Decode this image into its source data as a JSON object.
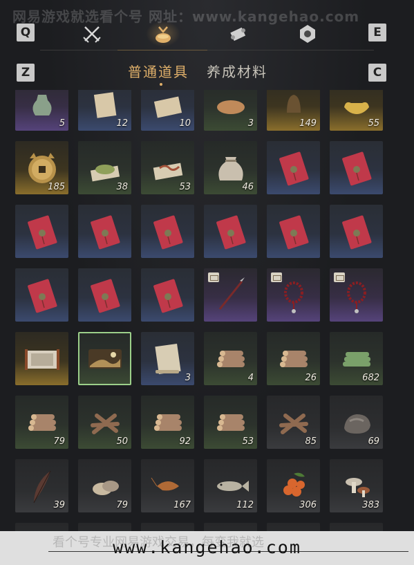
{
  "watermark": {
    "top_text": "网易游戏就选看个号  网址：www.kangehao.com",
    "bottom_url": "www.kangehao.com",
    "bottom_faint": "看个号专业网易游戏交易，每变我就选",
    "corner_mark": "看个号"
  },
  "toolbar": {
    "key_left": "Q",
    "key_right": "E",
    "icons": [
      "crossed-swords-icon",
      "money-bag-icon",
      "scroll-icon",
      "token-icon"
    ],
    "active_index": 1
  },
  "subtabs": {
    "key_left": "Z",
    "key_right": "C",
    "tab1": "普通道具",
    "tab2": "养成材料",
    "active": "普通道具"
  },
  "colors": {
    "accent": "#e0b06a",
    "rarity_blue": "#3b4a6e",
    "rarity_green": "#3c4b34",
    "rarity_purple": "#55437a",
    "rarity_gold": "#8a6e2c"
  },
  "grid": [
    {
      "rarity": "purple",
      "icon": "jade-vase-icon",
      "qty": "5"
    },
    {
      "rarity": "blue",
      "icon": "letter-icon",
      "qty": "12"
    },
    {
      "rarity": "blue",
      "icon": "paper-icon",
      "qty": "10"
    },
    {
      "rarity": "green",
      "icon": "bread-icon",
      "qty": "3"
    },
    {
      "rarity": "gold",
      "icon": "bell-icon",
      "qty": "149"
    },
    {
      "rarity": "gold",
      "icon": "gold-ingot-icon",
      "qty": "55"
    },
    {
      "rarity": "gold",
      "icon": "cat-coin-icon",
      "qty": "185"
    },
    {
      "rarity": "green",
      "icon": "powder-icon",
      "qty": "38"
    },
    {
      "rarity": "green",
      "icon": "worm-icon",
      "qty": "53"
    },
    {
      "rarity": "green",
      "icon": "cloth-sack-icon",
      "qty": "46"
    },
    {
      "rarity": "blue",
      "icon": "red-envelope-icon",
      "qty": ""
    },
    {
      "rarity": "blue",
      "icon": "red-envelope-icon",
      "qty": ""
    },
    {
      "rarity": "blue",
      "icon": "red-envelope-icon",
      "qty": ""
    },
    {
      "rarity": "blue",
      "icon": "red-envelope-icon",
      "qty": ""
    },
    {
      "rarity": "blue",
      "icon": "red-envelope-icon",
      "qty": ""
    },
    {
      "rarity": "blue",
      "icon": "red-envelope-icon",
      "qty": ""
    },
    {
      "rarity": "blue",
      "icon": "red-envelope-icon",
      "qty": ""
    },
    {
      "rarity": "blue",
      "icon": "red-envelope-icon",
      "qty": ""
    },
    {
      "rarity": "blue",
      "icon": "red-envelope-icon",
      "qty": ""
    },
    {
      "rarity": "blue",
      "icon": "red-envelope-icon",
      "qty": ""
    },
    {
      "rarity": "blue",
      "icon": "red-envelope-icon",
      "qty": ""
    },
    {
      "rarity": "purple",
      "icon": "spear-icon",
      "qty": "",
      "badge": true
    },
    {
      "rarity": "purple",
      "icon": "prayer-beads-icon",
      "qty": "",
      "badge": true
    },
    {
      "rarity": "purple",
      "icon": "prayer-beads-icon",
      "qty": "",
      "badge": true
    },
    {
      "rarity": "gold",
      "icon": "painting-scroll-icon",
      "qty": ""
    },
    {
      "rarity": "green",
      "icon": "landscape-painting-icon",
      "qty": "",
      "selected": true
    },
    {
      "rarity": "blue",
      "icon": "blank-scroll-icon",
      "qty": "3"
    },
    {
      "rarity": "green",
      "icon": "wood-logs-icon",
      "qty": "4"
    },
    {
      "rarity": "green",
      "icon": "wood-logs-icon",
      "qty": "26"
    },
    {
      "rarity": "green",
      "icon": "bamboo-bundle-icon",
      "qty": "682"
    },
    {
      "rarity": "green",
      "icon": "wood-logs-icon",
      "qty": "79"
    },
    {
      "rarity": "green",
      "icon": "firewood-icon",
      "qty": "50"
    },
    {
      "rarity": "green",
      "icon": "wood-logs-icon",
      "qty": "92"
    },
    {
      "rarity": "green",
      "icon": "wood-logs-icon",
      "qty": "53"
    },
    {
      "rarity": "gray",
      "icon": "firewood-icon",
      "qty": "85"
    },
    {
      "rarity": "gray",
      "icon": "ore-stone-icon",
      "qty": "69"
    },
    {
      "rarity": "gray",
      "icon": "feather-icon",
      "qty": "39"
    },
    {
      "rarity": "gray",
      "icon": "oyster-icon",
      "qty": "79"
    },
    {
      "rarity": "gray",
      "icon": "shrimp-icon",
      "qty": "167"
    },
    {
      "rarity": "gray",
      "icon": "fish-icon",
      "qty": "112"
    },
    {
      "rarity": "gray",
      "icon": "berries-icon",
      "qty": "306"
    },
    {
      "rarity": "gray",
      "icon": "mushroom-icon",
      "qty": "383"
    },
    {
      "rarity": "gray",
      "icon": "eggs-icon",
      "qty": ""
    },
    {
      "rarity": "gray",
      "icon": "meat-icon",
      "qty": ""
    },
    {
      "rarity": "gray",
      "icon": "unknown-icon",
      "qty": ""
    },
    {
      "rarity": "gray",
      "icon": "jade-ore-icon",
      "qty": ""
    },
    {
      "rarity": "gray",
      "icon": "feathers-icon",
      "qty": ""
    },
    {
      "rarity": "gray",
      "icon": "shell-icon",
      "qty": ""
    }
  ]
}
